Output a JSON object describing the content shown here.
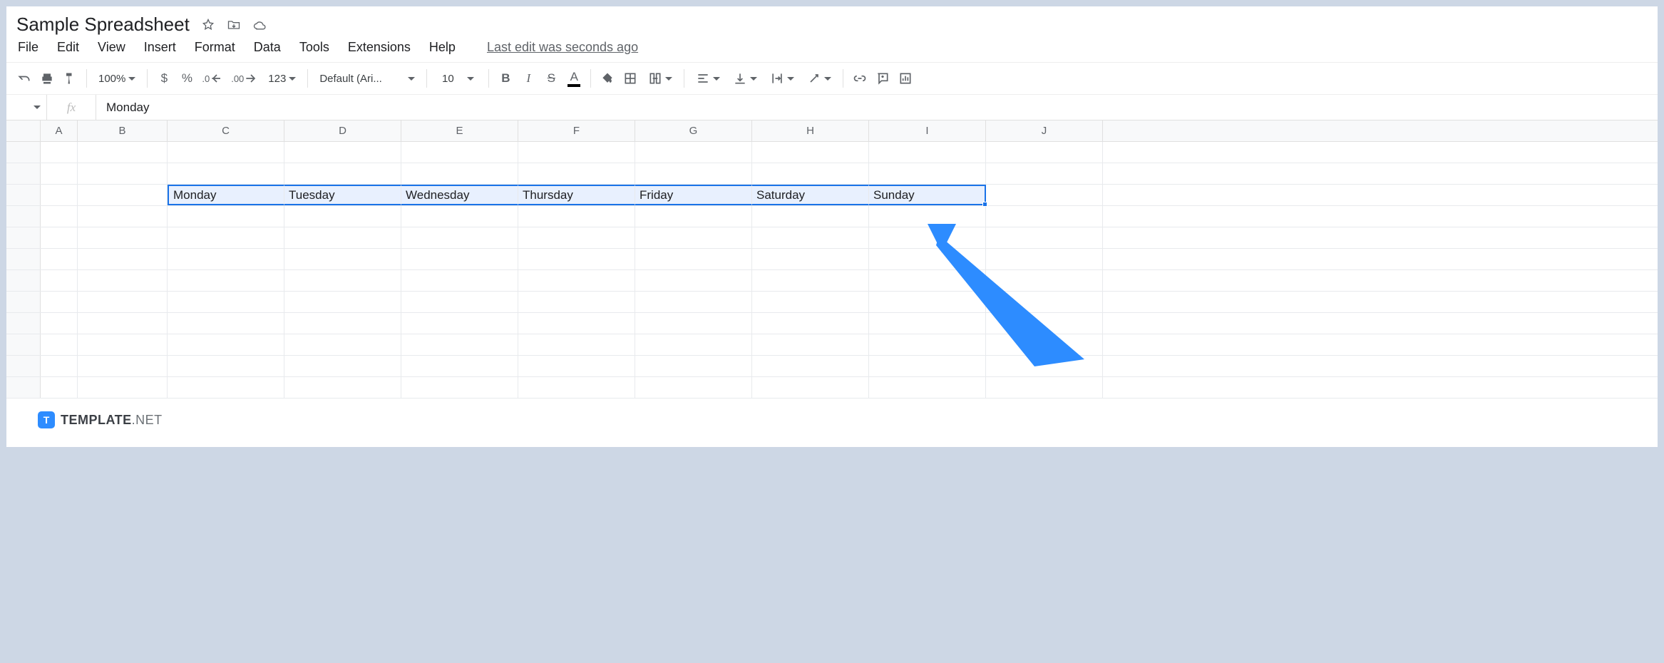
{
  "title": "Sample Spreadsheet",
  "menu": {
    "file": "File",
    "edit": "Edit",
    "view": "View",
    "insert": "Insert",
    "format": "Format",
    "data": "Data",
    "tools": "Tools",
    "extensions": "Extensions",
    "help": "Help",
    "last_edit": "Last edit was seconds ago"
  },
  "toolbar": {
    "zoom": "100%",
    "currency": "$",
    "percent": "%",
    "dec_dec": ".0",
    "inc_dec": ".00",
    "more_fmt": "123",
    "font": "Default (Ari...",
    "font_size": "10",
    "bold": "B",
    "italic": "I",
    "strike": "S",
    "text_color": "A"
  },
  "formula_bar": {
    "fx": "fx",
    "value": "Monday"
  },
  "columns": [
    "A",
    "B",
    "C",
    "D",
    "E",
    "F",
    "G",
    "H",
    "I",
    "J"
  ],
  "selection_row": {
    "c": "Monday",
    "d": "Tuesday",
    "e": "Wednesday",
    "f": "Thursday",
    "g": "Friday",
    "h": "Saturday",
    "i": "Sunday"
  },
  "watermark": {
    "badge": "T",
    "brand": "TEMPLATE",
    "suffix": ".NET"
  }
}
